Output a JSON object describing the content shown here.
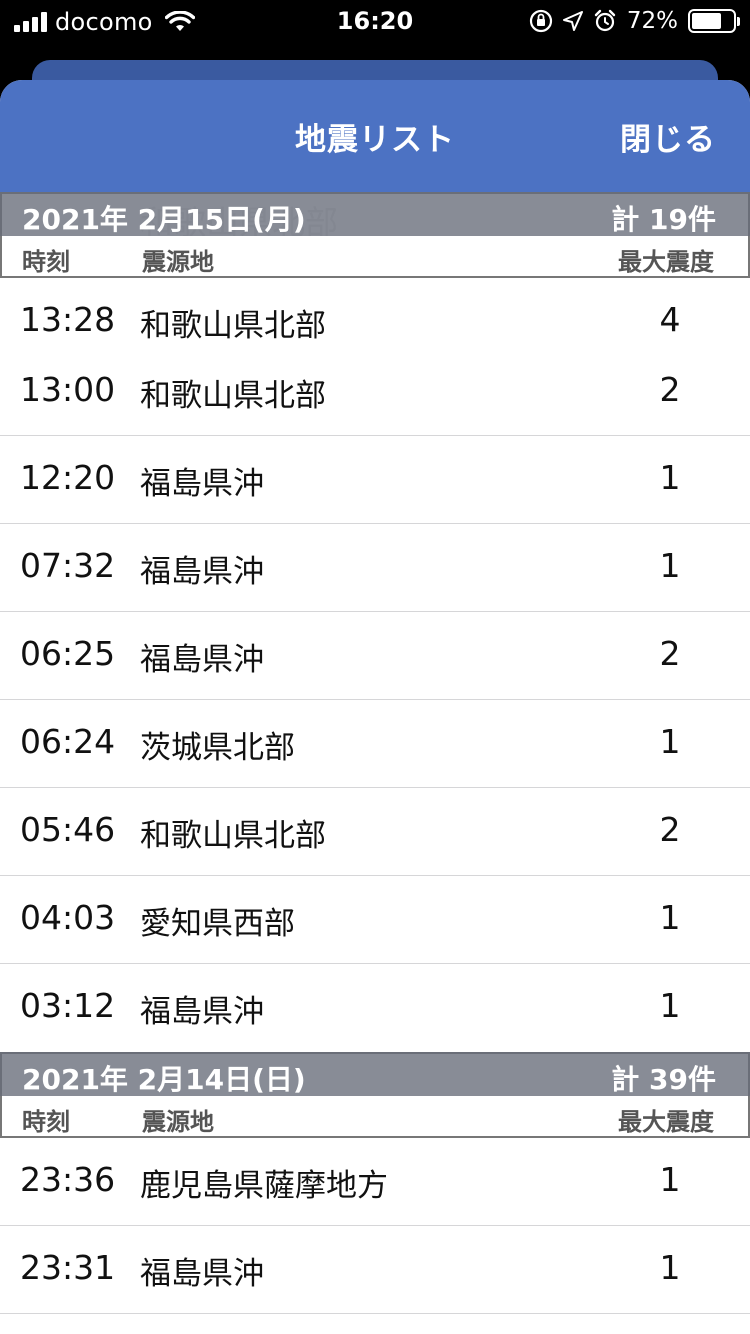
{
  "status_bar": {
    "carrier": "docomo",
    "time": "16:20",
    "battery_percent": "72%",
    "battery_level": 0.72
  },
  "nav": {
    "title": "地震リスト",
    "close_label": "閉じる"
  },
  "columns": {
    "time": "時刻",
    "epicenter": "震源地",
    "max_intensity": "最大震度"
  },
  "sections": [
    {
      "date": "2021年 2月15日(月)",
      "count": "計 19件",
      "rows": [
        {
          "time": "13:28",
          "place": "和歌山県北部",
          "intensity": "4"
        },
        {
          "time": "13:00",
          "place": "和歌山県北部",
          "intensity": "2"
        },
        {
          "time": "12:20",
          "place": "福島県沖",
          "intensity": "1"
        },
        {
          "time": "07:32",
          "place": "福島県沖",
          "intensity": "1"
        },
        {
          "time": "06:25",
          "place": "福島県沖",
          "intensity": "2"
        },
        {
          "time": "06:24",
          "place": "茨城県北部",
          "intensity": "1"
        },
        {
          "time": "05:46",
          "place": "和歌山県北部",
          "intensity": "2"
        },
        {
          "time": "04:03",
          "place": "愛知県西部",
          "intensity": "1"
        },
        {
          "time": "03:12",
          "place": "福島県沖",
          "intensity": "1"
        }
      ]
    },
    {
      "date": "2021年 2月14日(日)",
      "count": "計 39件",
      "rows": [
        {
          "time": "23:36",
          "place": "鹿児島県薩摩地方",
          "intensity": "1"
        },
        {
          "time": "23:31",
          "place": "福島県沖",
          "intensity": "1"
        }
      ]
    }
  ]
}
